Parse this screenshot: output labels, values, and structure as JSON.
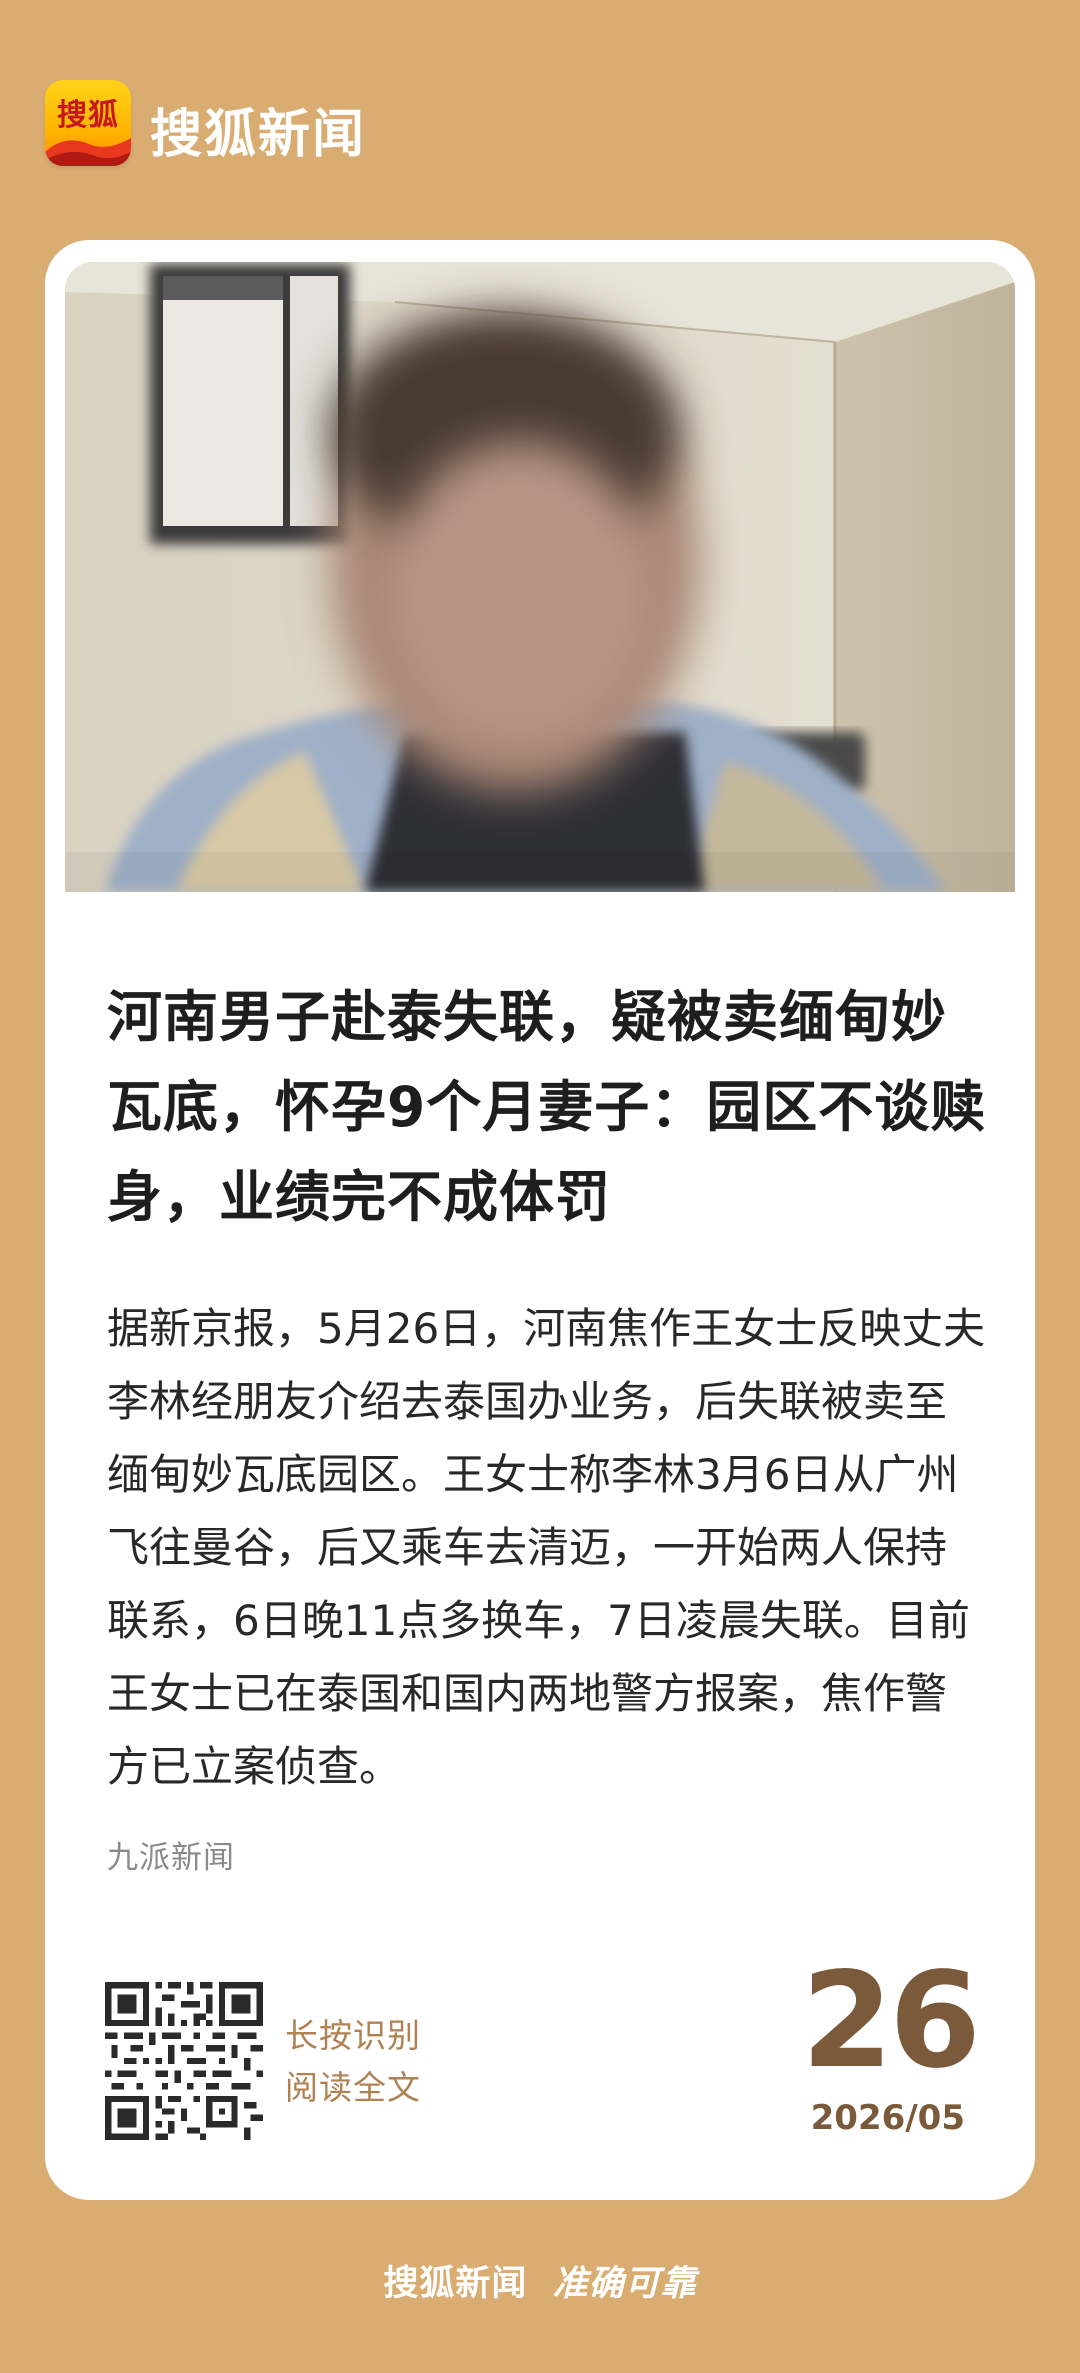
{
  "header": {
    "logo_text": "搜狐",
    "brand_name": "搜狐新闻"
  },
  "article": {
    "headline": "河南男子赴泰失联，疑被卖缅甸妙瓦底，怀孕9个月妻子：园区不谈赎身，业绩完不成体罚",
    "body": "据新京报，5月26日，河南焦作王女士反映丈夫李林经朋友介绍去泰国办业务，后失联被卖至缅甸妙瓦底园区。王女士称李林3月6日从广州飞往曼谷，后又乘车去清迈，一开始两人保持联系，6日晚11点多换车，7日凌晨失联。目前王女士已在泰国和国内两地警方报案，焦作警方已立案侦查。",
    "source": "九派新闻"
  },
  "footer_card": {
    "qr_line1": "长按识别",
    "qr_line2": "阅读全文",
    "day": "26",
    "year_month": "2026/05"
  },
  "slogan": {
    "part1": "搜狐新闻",
    "part2": "准确可靠"
  },
  "colors": {
    "background": "#d9ac72",
    "card": "#ffffff",
    "date": "#7a5a3a",
    "qr_caption": "#b08152"
  },
  "icons": {
    "logo": "sohu-logo-icon",
    "qr": "qr-code-icon"
  }
}
